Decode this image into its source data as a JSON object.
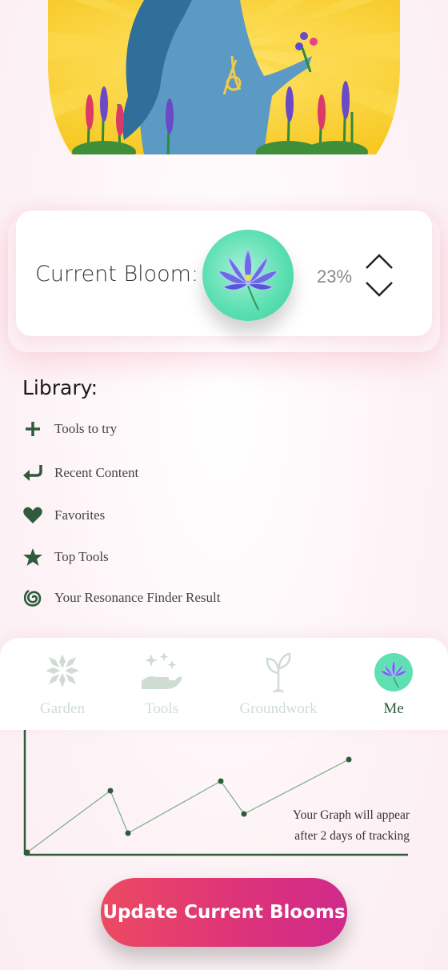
{
  "bloom": {
    "label": "Current Bloom:",
    "percent": "23%",
    "level": 23
  },
  "library": {
    "title": "Library:",
    "items": [
      {
        "label": "Tools to try",
        "icon": "plus-icon"
      },
      {
        "label": "Recent Content",
        "icon": "return-arrow-icon"
      },
      {
        "label": "Favorites",
        "icon": "heart-icon"
      },
      {
        "label": "Top Tools",
        "icon": "star-icon"
      },
      {
        "label": "Your Resonance Finder Result",
        "icon": "spiral-icon"
      }
    ]
  },
  "tabs": [
    {
      "label": "Garden",
      "icon": "garden-pattern-icon",
      "active": false
    },
    {
      "label": "Tools",
      "icon": "sparkle-hand-icon",
      "active": false
    },
    {
      "label": "Groundwork",
      "icon": "sprout-icon",
      "active": false
    },
    {
      "label": "Me",
      "icon": "lotus-avatar-icon",
      "active": true
    }
  ],
  "graph": {
    "note_line1": "Your Graph will appear",
    "note_line2": "after 2 days of tracking"
  },
  "update_button": {
    "label": "Update Current Blooms"
  },
  "colors": {
    "accent_green": "#2f5b3c",
    "inactive_tab": "#cfdcd4",
    "button_start": "#ec4a62",
    "button_end": "#cf2a8a",
    "bloom_badge": "#5ee0b3"
  }
}
